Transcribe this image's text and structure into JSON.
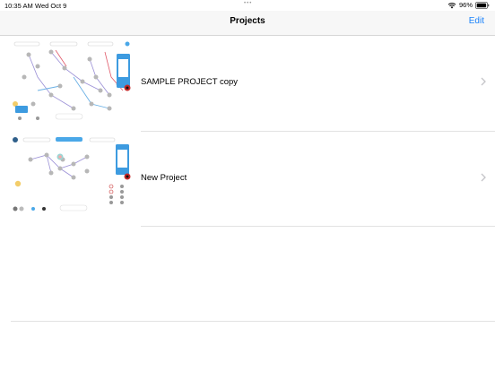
{
  "status_bar": {
    "time": "10:35 AM",
    "date": "Wed Oct 9",
    "battery_percent": "96%"
  },
  "nav": {
    "title": "Projects",
    "edit_label": "Edit"
  },
  "projects": [
    {
      "name": "SAMPLE PROJECT copy"
    },
    {
      "name": "New Project"
    }
  ],
  "colors": {
    "accent": "#1a82fb",
    "separator": "#e2e2e2",
    "nav_background": "#f7f7f7"
  }
}
